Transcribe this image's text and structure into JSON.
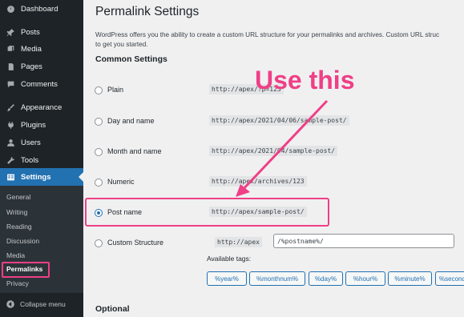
{
  "sidebar": {
    "items": [
      {
        "label": "Dashboard",
        "icon": "dashboard-icon"
      },
      {
        "label": "Posts",
        "icon": "pin-icon"
      },
      {
        "label": "Media",
        "icon": "media-icon"
      },
      {
        "label": "Pages",
        "icon": "page-icon"
      },
      {
        "label": "Comments",
        "icon": "comment-icon"
      },
      {
        "label": "Appearance",
        "icon": "brush-icon"
      },
      {
        "label": "Plugins",
        "icon": "plug-icon"
      },
      {
        "label": "Users",
        "icon": "user-icon"
      },
      {
        "label": "Tools",
        "icon": "wrench-icon"
      },
      {
        "label": "Settings",
        "icon": "settings-icon"
      }
    ],
    "submenu": [
      "General",
      "Writing",
      "Reading",
      "Discussion",
      "Media",
      "Permalinks",
      "Privacy"
    ],
    "collapse_label": "Collapse menu"
  },
  "page": {
    "title": "Permalink Settings",
    "intro_line1": "WordPress offers you the ability to create a custom URL structure for your permalinks and archives. Custom URL struc",
    "intro_line2": "to get you started.",
    "common_settings": "Common Settings",
    "options": [
      {
        "label": "Plain",
        "code": "http://apex/?p=123",
        "checked": false
      },
      {
        "label": "Day and name",
        "code": "http://apex/2021/04/06/sample-post/",
        "checked": false
      },
      {
        "label": "Month and name",
        "code": "http://apex/2021/04/sample-post/",
        "checked": false
      },
      {
        "label": "Numeric",
        "code": "http://apex/archives/123",
        "checked": false
      },
      {
        "label": "Post name",
        "code": "http://apex/sample-post/",
        "checked": true
      }
    ],
    "custom": {
      "label": "Custom Structure",
      "prefix": "http://apex",
      "value": "/%postname%/",
      "available_tags_label": "Available tags:",
      "tags": [
        "%year%",
        "%monthnum%",
        "%day%",
        "%hour%",
        "%minute%",
        "%second%"
      ]
    },
    "optional": "Optional"
  },
  "annotation": {
    "text": "Use this",
    "color": "#ef3f86"
  },
  "colors": {
    "sidebar": "#1d2327",
    "active": "#2271b1",
    "highlight": "#ef3f86"
  }
}
